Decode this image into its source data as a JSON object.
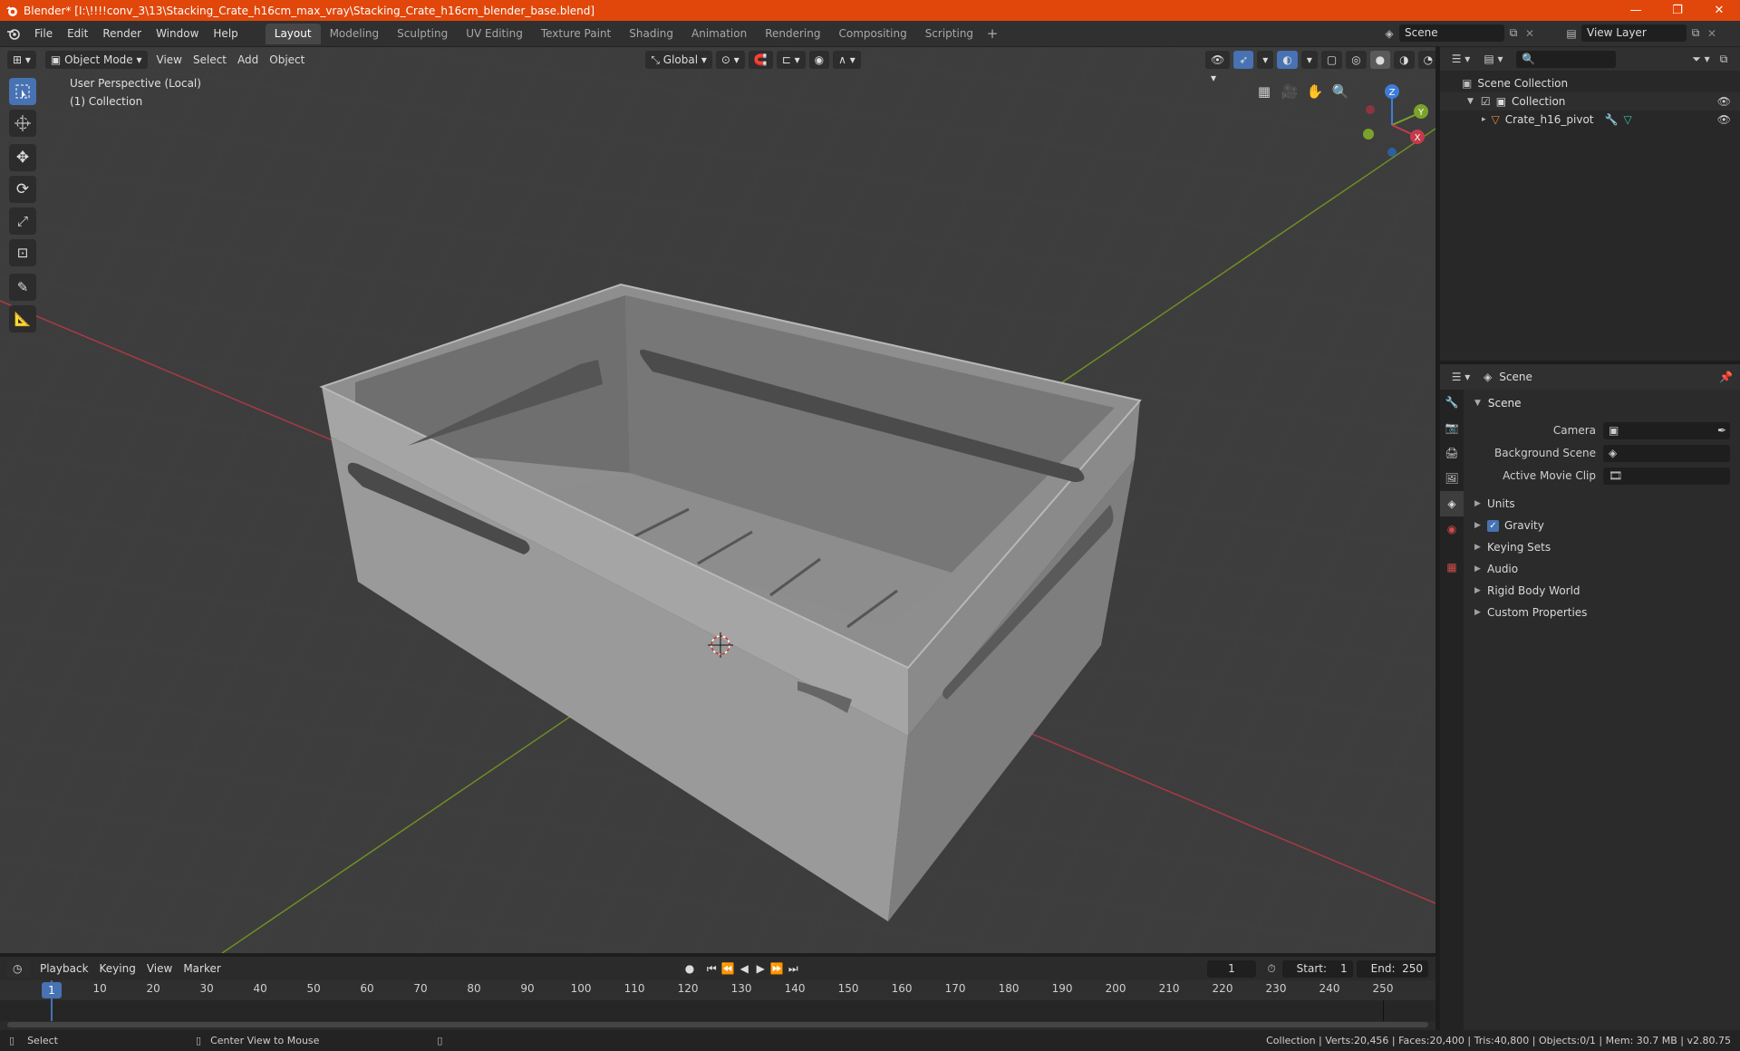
{
  "window": {
    "title": "Blender* [I:\\!!!!conv_3\\13\\Stacking_Crate_h16cm_max_vray\\Stacking_Crate_h16cm_blender_base.blend]",
    "minimize": "—",
    "maximize": "❐",
    "close": "✕"
  },
  "menu": [
    "File",
    "Edit",
    "Render",
    "Window",
    "Help"
  ],
  "workspaces": [
    "Layout",
    "Modeling",
    "Sculpting",
    "UV Editing",
    "Texture Paint",
    "Shading",
    "Animation",
    "Rendering",
    "Compositing",
    "Scripting"
  ],
  "workspace_active": "Layout",
  "scene_selector": {
    "value": "Scene"
  },
  "view_layer_selector": {
    "value": "View Layer"
  },
  "viewport_header": {
    "mode": "Object Mode",
    "menus": [
      "View",
      "Select",
      "Add",
      "Object"
    ],
    "transform_orientation": "Global"
  },
  "viewport": {
    "perspective_label": "User Perspective (Local)",
    "collection_label": "(1) Collection",
    "gizmo": {
      "z": "Z",
      "y": "Y",
      "x": "X"
    }
  },
  "outliner": {
    "search_placeholder": "",
    "scene_collection": "Scene Collection",
    "collection": "Collection",
    "object": "Crate_h16_pivot"
  },
  "properties": {
    "breadcrumb": "Scene",
    "panel_title": "Scene",
    "fields": [
      {
        "label": "Camera"
      },
      {
        "label": "Background Scene"
      },
      {
        "label": "Active Movie Clip"
      }
    ],
    "subpanels": [
      "Units",
      "Gravity",
      "Keying Sets",
      "Audio",
      "Rigid Body World",
      "Custom Properties"
    ],
    "gravity_checked": true
  },
  "timeline": {
    "menus": [
      "Playback",
      "Keying",
      "View",
      "Marker"
    ],
    "current_frame": "1",
    "start_label": "Start:",
    "start_value": "1",
    "end_label": "End:",
    "end_value": "250",
    "ticks": [
      "1",
      "10",
      "20",
      "30",
      "40",
      "50",
      "60",
      "70",
      "80",
      "90",
      "100",
      "110",
      "120",
      "130",
      "140",
      "150",
      "160",
      "170",
      "180",
      "190",
      "200",
      "210",
      "220",
      "230",
      "240",
      "250"
    ]
  },
  "statusbar": {
    "select": "Select",
    "center_view": "Center View to Mouse",
    "stats": "Collection | Verts:20,456 | Faces:20,400 | Tris:40,800 | Objects:0/1 | Mem: 30.7 MB | v2.80.75"
  },
  "colors": {
    "titlebar": "#e1470b",
    "accent": "#4772b3",
    "axis_x": "#c53b4b",
    "axis_y": "#7ba32a",
    "axis_z": "#3d7dd8"
  }
}
